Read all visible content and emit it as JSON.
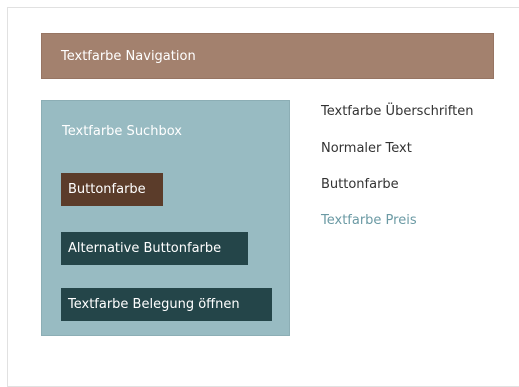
{
  "navigation": {
    "label": "Textfarbe Navigation"
  },
  "searchbox": {
    "label": "Textfarbe Suchbox",
    "buttons": {
      "primary": "Buttonfarbe",
      "alternative": "Alternative Buttonfarbe",
      "open_booking": "Textfarbe Belegung öffnen"
    }
  },
  "legend": {
    "headings": "Textfarbe Überschriften",
    "normal_text": "Normaler Text",
    "button_color": "Buttonfarbe",
    "price_color": "Textfarbe Preis"
  },
  "colors": {
    "navigation_bg": "#a3816e",
    "searchbox_bg": "#98bbc2",
    "button_bg": "#5b3c2a",
    "alt_button_bg": "#244549",
    "body_text": "#333333",
    "price_text": "#6b9aa4"
  }
}
